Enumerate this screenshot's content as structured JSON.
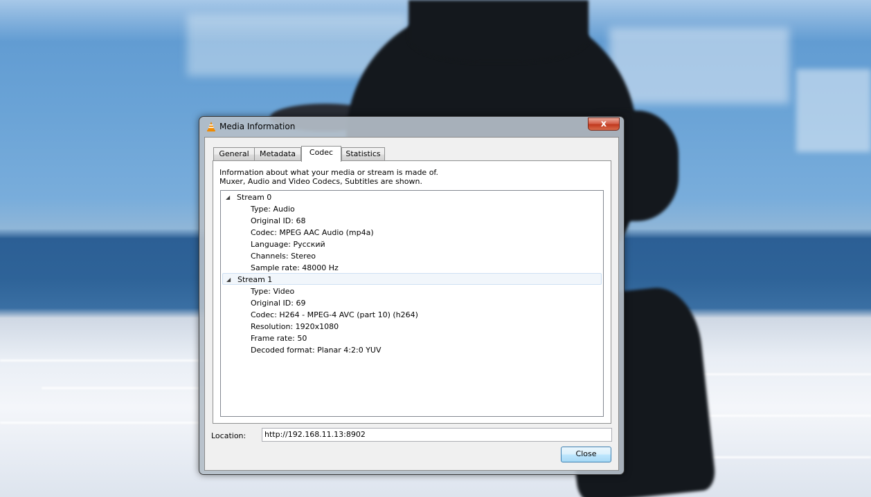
{
  "window": {
    "title": "Media Information",
    "close_glyph": "x"
  },
  "tabs": [
    {
      "label": "General",
      "active": false
    },
    {
      "label": "Metadata",
      "active": false
    },
    {
      "label": "Codec",
      "active": true
    },
    {
      "label": "Statistics",
      "active": false
    }
  ],
  "codec_panel": {
    "description_line1": "Information about what your media or stream is made of.",
    "description_line2": "Muxer, Audio and Video Codecs, Subtitles are shown.",
    "streams": [
      {
        "label": "Stream 0",
        "expanded": true,
        "selected": false,
        "details": [
          "Type: Audio",
          "Original ID: 68",
          "Codec: MPEG AAC Audio (mp4a)",
          "Language: Русский",
          "Channels: Stereo",
          "Sample rate: 48000 Hz"
        ]
      },
      {
        "label": "Stream 1",
        "expanded": true,
        "selected": true,
        "details": [
          "Type: Video",
          "Original ID: 69",
          "Codec: H264 - MPEG-4 AVC (part 10) (h264)",
          "Resolution: 1920x1080",
          "Frame rate: 50",
          "Decoded format: Planar 4:2:0 YUV"
        ]
      }
    ]
  },
  "location": {
    "label": "Location:",
    "value": "http://192.168.11.13:8902"
  },
  "buttons": {
    "close_label": "Close"
  },
  "icons": {
    "app": "vlc-cone-icon",
    "expander": "triangle-expanded-icon"
  },
  "colors": {
    "vlc_orange": "#f08a00",
    "close_red": "#c0391f",
    "selection_border": "#cde0f3"
  }
}
